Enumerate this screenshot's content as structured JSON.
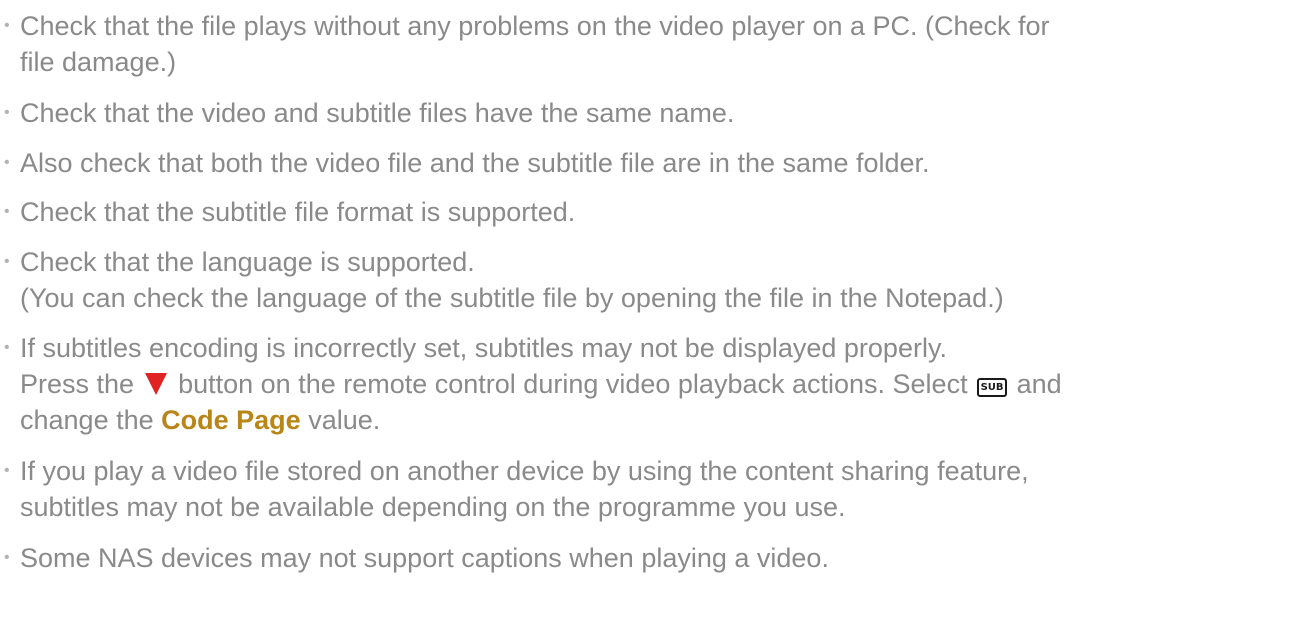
{
  "items": [
    {
      "line1": "Check that the file plays without any problems on the video player on a PC. (Check for",
      "line2": "file damage.)"
    },
    {
      "line1": "Check that the video and subtitle files have the same name."
    },
    {
      "line1": "Also check that both the video file and the subtitle file are in the same folder."
    },
    {
      "line1": "Check that the subtitle file format is supported."
    },
    {
      "line1": "Check that the language is supported.",
      "line2": "(You can check the language of the subtitle file by opening the file in the Notepad.)"
    },
    {
      "line1": "If subtitles encoding is incorrectly set, subtitles may not be displayed properly.",
      "line2_a": "Press the",
      "line2_b": "button on the remote control during video playback actions. Select",
      "line2_c": "and",
      "line3_a": "change the",
      "line3_kw": "Code Page",
      "line3_b": "value.",
      "sub_icon_text": "SUB"
    },
    {
      "line1": "If you play a video file stored on another device by using the content sharing feature,",
      "line2": "subtitles may not be available depending on the programme you use."
    },
    {
      "line1": "Some NAS devices may not support captions when playing a video."
    }
  ],
  "bullet_char": "•",
  "icons": {
    "down_button": "down-arrow-icon",
    "sub_button": "sub-button-icon"
  },
  "colors": {
    "text": "#8a8a8a",
    "keyword": "#b88618",
    "arrow": "#e02424"
  }
}
